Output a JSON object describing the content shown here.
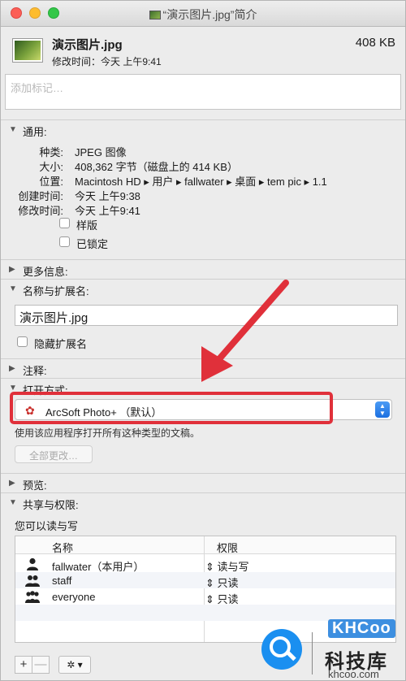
{
  "window": {
    "title": "“演示图片.jpg”简介"
  },
  "header": {
    "file_name": "演示图片.jpg",
    "file_size": "408 KB",
    "modified": "修改时间：今天 上午9:41"
  },
  "tags": {
    "placeholder": "添加标记…"
  },
  "general": {
    "label": "通用:",
    "kind_label": "种类:",
    "kind_value": "JPEG 图像",
    "size_label": "大小:",
    "size_value": "408,362 字节（磁盘上的 414 KB）",
    "where_label": "位置:",
    "where_value": "Macintosh HD ▸ 用户 ▸ fallwater ▸ 桌面 ▸ tem pic ▸ 1.1",
    "created_label": "创建时间:",
    "created_value": "今天 上午9:38",
    "modified_label": "修改时间:",
    "modified_value": "今天 上午9:41",
    "stationery_label": "样版",
    "locked_label": "已锁定"
  },
  "more_info": {
    "label": "更多信息:"
  },
  "name_ext": {
    "label": "名称与扩展名:",
    "value": "演示图片.jpg",
    "hide_ext_label": "隐藏扩展名"
  },
  "comments": {
    "label": "注释:"
  },
  "open_with": {
    "label": "打开方式:",
    "app": "ArcSoft Photo+ （默认）",
    "hint": "使用该应用程序打开所有这种类型的文稿。",
    "change_all": "全部更改…"
  },
  "preview": {
    "label": "预览:"
  },
  "sharing": {
    "label": "共享与权限:",
    "sub": "您可以读与写",
    "col_name": "名称",
    "col_privilege": "权限",
    "rows": [
      {
        "name": "fallwater（本用户）",
        "privilege": "读与写"
      },
      {
        "name": "staff",
        "privilege": "只读"
      },
      {
        "name": "everyone",
        "privilege": "只读"
      }
    ]
  },
  "toolbar": {
    "add": "+",
    "remove": "—",
    "gear": "✲ ▾"
  },
  "watermark": {
    "brand": "KHCoo",
    "title": "科技库",
    "domain": "khcoo.com"
  },
  "colors": {
    "highlight": "#e0303a",
    "select_accent": "#1b6fe0"
  }
}
